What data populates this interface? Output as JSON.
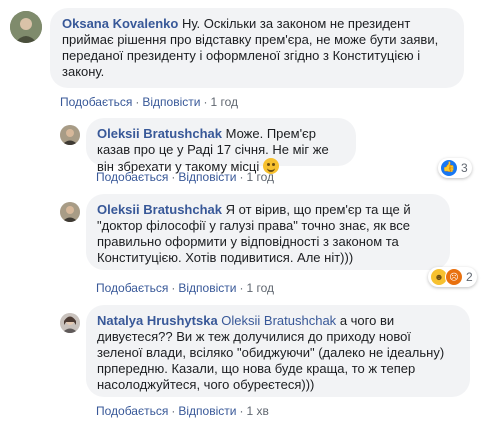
{
  "comments": [
    {
      "author": "Oksana Kovalenko",
      "text": "Ну. Оскільки за законом не президент приймає рішення про відставку прем'єра, не може бути заяви, переданої президенту і оформленої згідно з Конституцією і закону.",
      "like_label": "Подобається",
      "reply_label": "Відповісти",
      "time": "1 год",
      "avatar_color": "#6f7d62"
    },
    {
      "author": "Oleksii Bratushchak",
      "text": "Може. Прем'єр казав про це у Раді 17 січня. Не міг же він збрехати у такому місці",
      "emoji": "smiling-face-icon",
      "like_label": "Подобається",
      "reply_label": "Відповісти",
      "time": "1 год",
      "reaction_count": "3",
      "reactions": [
        "like-icon"
      ],
      "avatar_color": "#8a7a62"
    },
    {
      "author": "Oleksii Bratushchak",
      "text": "Я от вірив, що прем'єр та ще й \"доктор філософії у галузі права\" точно знає, як все правильно оформити у відповідності з законом та Конституцією. Хотів подивитися. Але ніт)))",
      "like_label": "Подобається",
      "reply_label": "Відповісти",
      "time": "1 год",
      "reaction_count": "2",
      "reactions": [
        "haha-icon",
        "angry-icon"
      ],
      "avatar_color": "#8a7a62"
    },
    {
      "author": "Natalya Hrushytska",
      "tagged": "Oleksii Bratushchak",
      "text": "а чого ви дивуєтеся?? Ви ж теж долучилися до приходу нової зеленої влади, всіляко \"обиджуючи\" (далеко не ідеальну) прпередню. Казали, що нова буде краща, то ж тепер насолоджуйтеся, чого обуреєтеся)))",
      "like_label": "Подобається",
      "reply_label": "Відповісти",
      "time": "1 хв",
      "avatar_color": "#9c8f8a"
    }
  ],
  "separator": "·"
}
